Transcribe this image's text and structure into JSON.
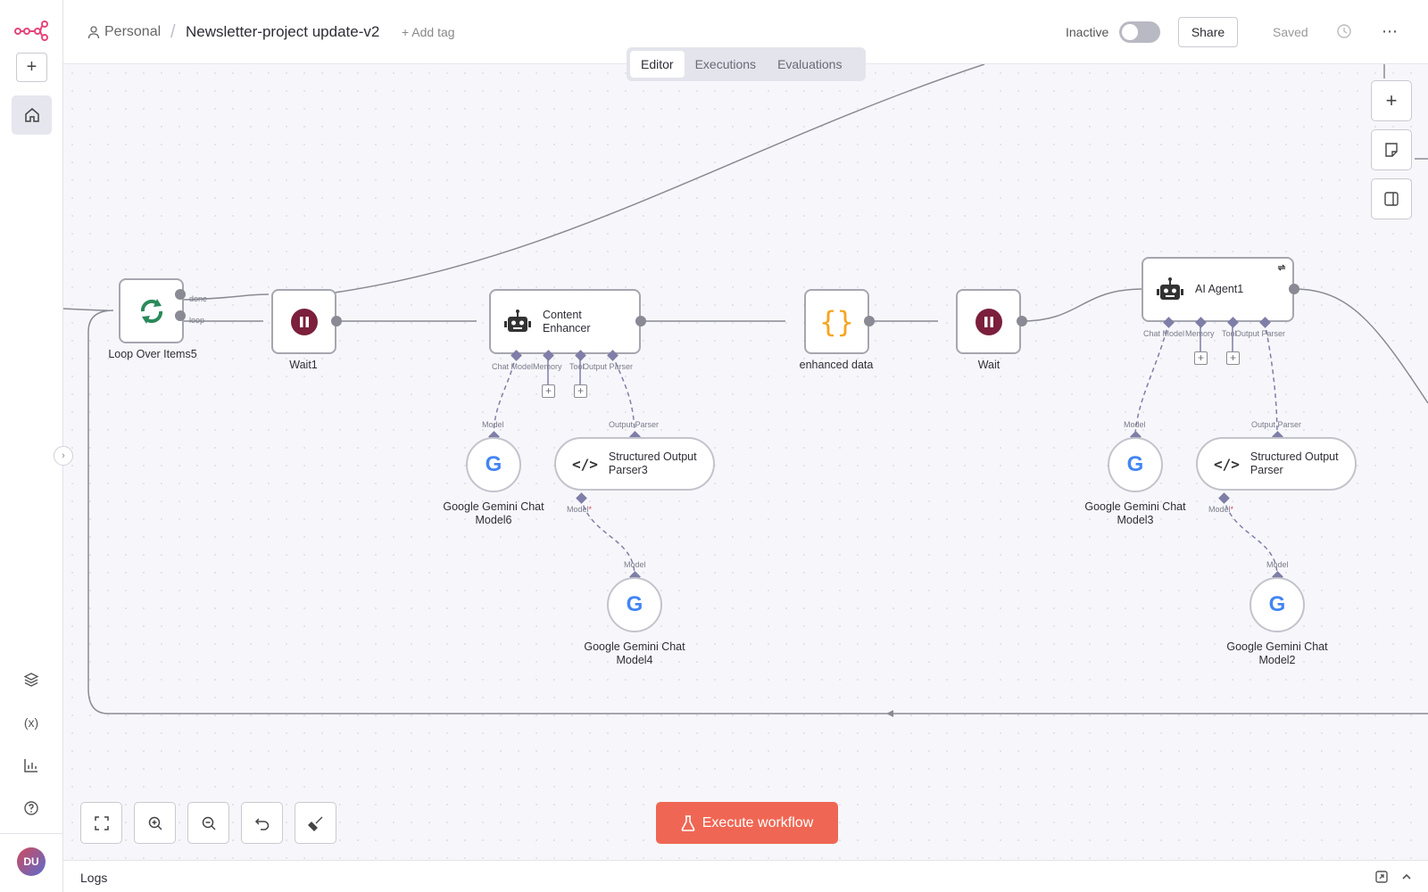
{
  "header": {
    "breadcrumb_personal": "Personal",
    "breadcrumb_sep": "/",
    "workflow_title": "Newsletter-project update-v2",
    "add_tag": "+ Add tag",
    "status_label": "Inactive",
    "share_label": "Share",
    "saved_label": "Saved"
  },
  "tabs": [
    "Editor",
    "Executions",
    "Evaluations"
  ],
  "sidebar": {
    "avatar_initials": "DU"
  },
  "nodes": {
    "loop": {
      "label": "Loop Over Items5",
      "port_done": "done",
      "port_loop": "loop"
    },
    "wait1": {
      "label": "Wait1"
    },
    "content_enhancer": {
      "label_line1": "Content",
      "label_line2": "Enhancer"
    },
    "enhanced_data": {
      "label": "enhanced data"
    },
    "wait": {
      "label": "Wait"
    },
    "ai_agent1": {
      "label": "AI Agent1"
    },
    "gemini6": {
      "line1": "Google Gemini Chat",
      "line2": "Model6"
    },
    "parser3": {
      "line1": "Structured Output",
      "line2": "Parser3"
    },
    "gemini4": {
      "line1": "Google Gemini Chat",
      "line2": "Model4"
    },
    "gemini3": {
      "line1": "Google Gemini Chat",
      "line2": "Model3"
    },
    "parser": {
      "line1": "Structured Output",
      "line2": "Parser"
    },
    "gemini2": {
      "line1": "Google Gemini Chat",
      "line2": "Model2"
    }
  },
  "port_labels": {
    "chat_model": "Chat Model",
    "memory": "Memory",
    "tool": "Tool",
    "output_parser": "Output Parser",
    "model": "Model",
    "model_required": "Model",
    "required_mark": "*"
  },
  "execute_label": "Execute workflow",
  "logs_label": "Logs",
  "colors": {
    "accent": "#ef6754",
    "wait_node": "#7b1f3c",
    "loop_node": "#2a8a5a",
    "code_node": "#f5a623",
    "edge": "#8a8a94",
    "ai_port": "#7e7ea8"
  }
}
